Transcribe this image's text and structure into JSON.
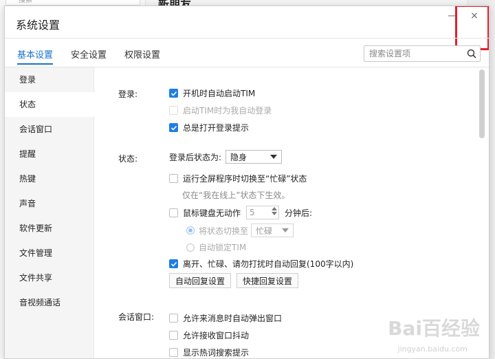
{
  "background": {
    "search_text": "搜索",
    "title": "新朋友"
  },
  "dialog": {
    "title": "系统设置",
    "close_glyph": "×",
    "minimize_glyph": "—"
  },
  "tabs": [
    {
      "label": "基本设置",
      "active": true
    },
    {
      "label": "安全设置",
      "active": false
    },
    {
      "label": "权限设置",
      "active": false
    }
  ],
  "search": {
    "placeholder": "搜索设置项",
    "icon": "search-icon"
  },
  "sidebar": {
    "items": [
      {
        "label": "登录",
        "active": false
      },
      {
        "label": "状态",
        "active": true
      },
      {
        "label": "会话窗口",
        "active": false
      },
      {
        "label": "提醒",
        "active": false
      },
      {
        "label": "热键",
        "active": false
      },
      {
        "label": "声音",
        "active": false
      },
      {
        "label": "软件更新",
        "active": false
      },
      {
        "label": "文件管理",
        "active": false
      },
      {
        "label": "文件共享",
        "active": false
      },
      {
        "label": "音视频通话",
        "active": false
      }
    ]
  },
  "login": {
    "label": "登录:",
    "auto_start": {
      "label": "开机时自动启动TIM",
      "checked": true
    },
    "auto_login": {
      "label": "启动TIM时为我自动登录",
      "checked": false,
      "disabled": true
    },
    "show_tip": {
      "label": "总是打开登录提示",
      "checked": true
    }
  },
  "status": {
    "label": "状态:",
    "after_login_label": "登录后状态为:",
    "after_login_value": "隐身",
    "fullscreen_busy": {
      "label": "运行全屏程序时切换至“忙碌”状态",
      "checked": false
    },
    "fullscreen_hint": "仅在“我在线上”状态下生效。",
    "idle": {
      "label": "鼠标键盘无动作",
      "checked": false,
      "minutes": "5",
      "suffix": "分钟后:"
    },
    "switch_status": {
      "label": "将状态切换至",
      "value": "忙碌",
      "selected": true,
      "disabled": true
    },
    "auto_lock": {
      "label": "自动锁定TIM",
      "selected": false,
      "disabled": true
    },
    "auto_reply": {
      "label": "离开、忙碌、请勿打扰时自动回复(100字以内)",
      "checked": true
    },
    "auto_reply_settings_button": "自动回复设置",
    "quick_reply_settings_button": "快捷回复设置"
  },
  "session": {
    "label": "会话窗口:",
    "popup": {
      "label": "允许来消息时自动弹出窗口",
      "checked": false
    },
    "shake": {
      "label": "允许接收窗口抖动",
      "checked": false
    },
    "hot_search": {
      "label": "显示热词搜索提示",
      "checked": false
    }
  },
  "watermark": {
    "text": "Bai百经验",
    "sub": "jingyan.baidu.com"
  },
  "colors": {
    "accent": "#1a73c8",
    "checkbox": "#1e7ee4",
    "highlight": "#e0212e"
  }
}
